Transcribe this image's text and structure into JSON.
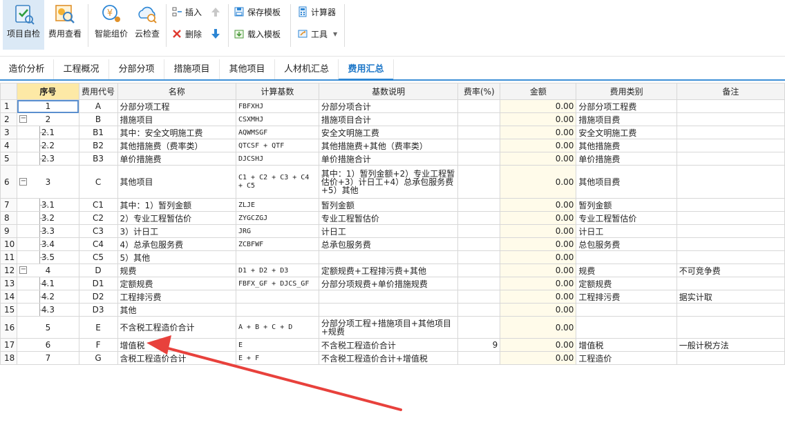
{
  "ribbon": {
    "project_check": "项目自检",
    "fee_view": "费用查看",
    "smart_price": "智能组价",
    "cloud_check": "云检查",
    "insert": "插入",
    "delete": "删除",
    "save_template": "保存模板",
    "load_template": "载入模板",
    "calculator": "计算器",
    "tools": "工具"
  },
  "tabs": [
    "造价分析",
    "工程概况",
    "分部分项",
    "措施项目",
    "其他项目",
    "人材机汇总",
    "费用汇总"
  ],
  "active_tab": "费用汇总",
  "columns": {
    "seq": "序号",
    "code": "费用代号",
    "name": "名称",
    "base": "计算基数",
    "desc": "基数说明",
    "rate": "费率(%)",
    "amount": "金额",
    "category": "费用类别",
    "note": "备注"
  },
  "rows": [
    {
      "rn": "1",
      "seq": "1",
      "code": "A",
      "name": "分部分项工程",
      "base": "FBFXHJ",
      "desc": "分部分项合计",
      "rate": "",
      "amount": "0.00",
      "category": "分部分项工程费",
      "note": ""
    },
    {
      "rn": "2",
      "seq": "2",
      "code": "B",
      "name": "措施项目",
      "base": "CSXMHJ",
      "desc": "措施项目合计",
      "rate": "",
      "amount": "0.00",
      "category": "措施项目费",
      "note": ""
    },
    {
      "rn": "3",
      "seq": "2.1",
      "code": "B1",
      "name": "其中：安全文明施工费",
      "base": "AQWMSGF",
      "desc": "安全文明施工费",
      "rate": "",
      "amount": "0.00",
      "category": "安全文明施工费",
      "note": ""
    },
    {
      "rn": "4",
      "seq": "2.2",
      "code": "B2",
      "name": "其他措施费（费率类）",
      "base": "QTCSF + QTF",
      "desc": "其他措施费+其他（费率类）",
      "rate": "",
      "amount": "0.00",
      "category": "其他措施费",
      "note": ""
    },
    {
      "rn": "5",
      "seq": "2.3",
      "code": "B3",
      "name": "单价措施费",
      "base": "DJCSHJ",
      "desc": "单价措施合计",
      "rate": "",
      "amount": "0.00",
      "category": "单价措施费",
      "note": ""
    },
    {
      "rn": "6",
      "seq": "3",
      "code": "C",
      "name": "其他项目",
      "base": "C1 + C2 + C3 + C4 + C5",
      "desc": "其中：1）暂列金额+2）专业工程暂估价+3）计日工+4）总承包服务费+5）其他",
      "rate": "",
      "amount": "0.00",
      "category": "其他项目费",
      "note": ""
    },
    {
      "rn": "7",
      "seq": "3.1",
      "code": "C1",
      "name": "其中：1）暂列金额",
      "base": "ZLJE",
      "desc": "暂列金额",
      "rate": "",
      "amount": "0.00",
      "category": "暂列金额",
      "note": ""
    },
    {
      "rn": "8",
      "seq": "3.2",
      "code": "C2",
      "name": "2）专业工程暂估价",
      "base": "ZYGCZGJ",
      "desc": "专业工程暂估价",
      "rate": "",
      "amount": "0.00",
      "category": "专业工程暂估价",
      "note": ""
    },
    {
      "rn": "9",
      "seq": "3.3",
      "code": "C3",
      "name": "3）计日工",
      "base": "JRG",
      "desc": "计日工",
      "rate": "",
      "amount": "0.00",
      "category": "计日工",
      "note": ""
    },
    {
      "rn": "10",
      "seq": "3.4",
      "code": "C4",
      "name": "4）总承包服务费",
      "base": "ZCBFWF",
      "desc": "总承包服务费",
      "rate": "",
      "amount": "0.00",
      "category": "总包服务费",
      "note": ""
    },
    {
      "rn": "11",
      "seq": "3.5",
      "code": "C5",
      "name": "5）其他",
      "base": "",
      "desc": "",
      "rate": "",
      "amount": "0.00",
      "category": "",
      "note": ""
    },
    {
      "rn": "12",
      "seq": "4",
      "code": "D",
      "name": "规费",
      "base": "D1 + D2 + D3",
      "desc": "定额规费+工程排污费+其他",
      "rate": "",
      "amount": "0.00",
      "category": "规费",
      "note": "不可竞争费"
    },
    {
      "rn": "13",
      "seq": "4.1",
      "code": "D1",
      "name": "定额规费",
      "base": "FBFX_GF + DJCS_GF",
      "desc": "分部分项规费+单价措施规费",
      "rate": "",
      "amount": "0.00",
      "category": "定额规费",
      "note": ""
    },
    {
      "rn": "14",
      "seq": "4.2",
      "code": "D2",
      "name": "工程排污费",
      "base": "",
      "desc": "",
      "rate": "",
      "amount": "0.00",
      "category": "工程排污费",
      "note": "据实计取"
    },
    {
      "rn": "15",
      "seq": "4.3",
      "code": "D3",
      "name": "其他",
      "base": "",
      "desc": "",
      "rate": "",
      "amount": "0.00",
      "category": "",
      "note": ""
    },
    {
      "rn": "16",
      "seq": "5",
      "code": "E",
      "name": "不含税工程造价合计",
      "base": "A + B + C + D",
      "desc": "分部分项工程+措施项目+其他项目+规费",
      "rate": "",
      "amount": "0.00",
      "category": "",
      "note": ""
    },
    {
      "rn": "17",
      "seq": "6",
      "code": "F",
      "name": "增值税",
      "base": "E",
      "desc": "不含税工程造价合计",
      "rate": "9",
      "amount": "0.00",
      "category": "增值税",
      "note": "一般计税方法"
    },
    {
      "rn": "18",
      "seq": "7",
      "code": "G",
      "name": "含税工程造价合计",
      "base": "E + F",
      "desc": "不含税工程造价合计+增值税",
      "rate": "",
      "amount": "0.00",
      "category": "工程造价",
      "note": ""
    }
  ],
  "colors": {
    "accent": "#2d86d4",
    "header_highlight": "#fde9a6",
    "amount_bg": "#fffbea",
    "arrow": "#e8413c"
  }
}
